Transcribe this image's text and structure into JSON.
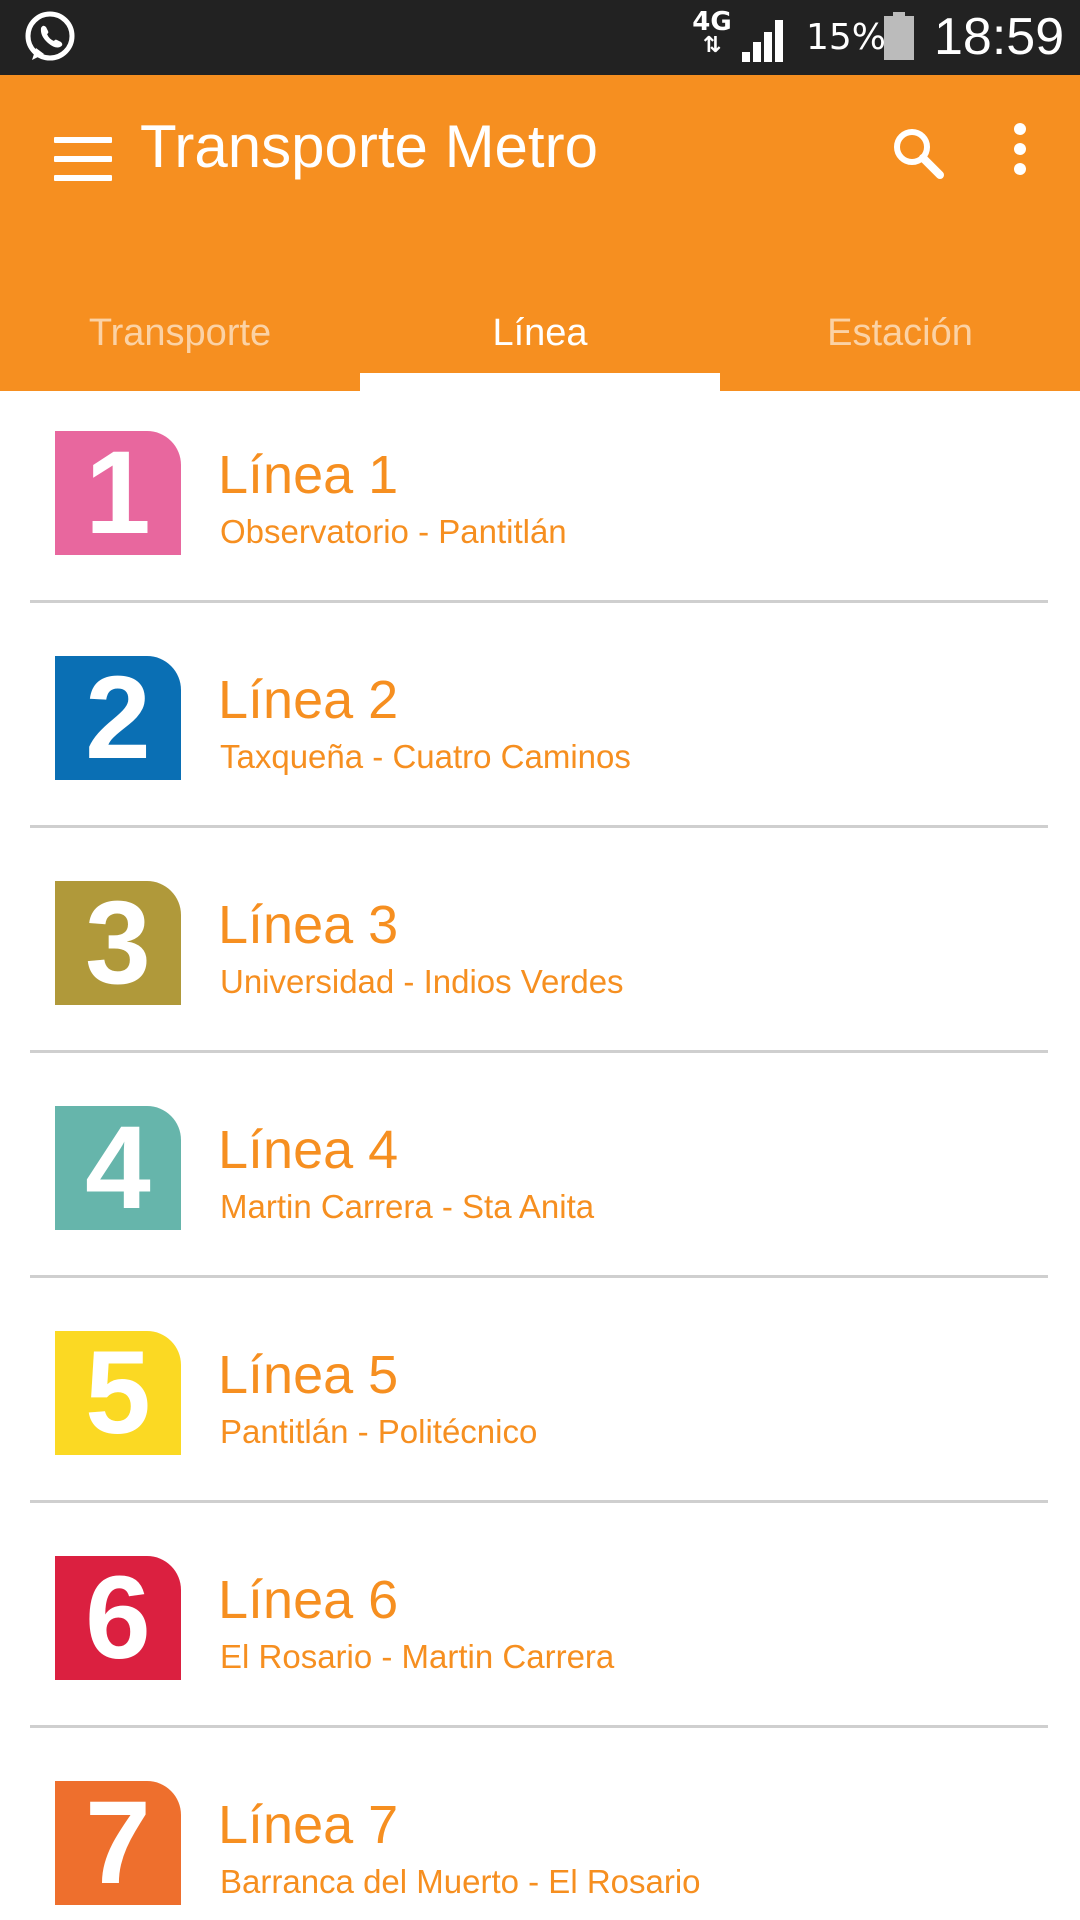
{
  "status_bar": {
    "network": "4G",
    "network_arrows": "⇅",
    "battery_percent": "15%",
    "time": "18:59"
  },
  "app_bar": {
    "title": "Transporte Metro",
    "color": "#f68f20"
  },
  "tabs": [
    {
      "label": "Transporte",
      "active": false
    },
    {
      "label": "Línea",
      "active": true
    },
    {
      "label": "Estación",
      "active": false
    }
  ],
  "lines": [
    {
      "number": "1",
      "title": "Línea 1",
      "route": "Observatorio - Pantitlán",
      "color": "#e8679e"
    },
    {
      "number": "2",
      "title": "Línea 2",
      "route": "Taxqueña - Cuatro Caminos",
      "color": "#0a6fb4"
    },
    {
      "number": "3",
      "title": "Línea 3",
      "route": "Universidad - Indios Verdes",
      "color": "#b0993a"
    },
    {
      "number": "4",
      "title": "Línea 4",
      "route": "Martin Carrera - Sta Anita",
      "color": "#66b5ab"
    },
    {
      "number": "5",
      "title": "Línea 5",
      "route": "Pantitlán - Politécnico",
      "color": "#fbd923"
    },
    {
      "number": "6",
      "title": "Línea 6",
      "route": "El Rosario - Martin Carrera",
      "color": "#db2040"
    },
    {
      "number": "7",
      "title": "Línea 7",
      "route": "Barranca del Muerto - El Rosario",
      "color": "#ee6f2d"
    }
  ]
}
